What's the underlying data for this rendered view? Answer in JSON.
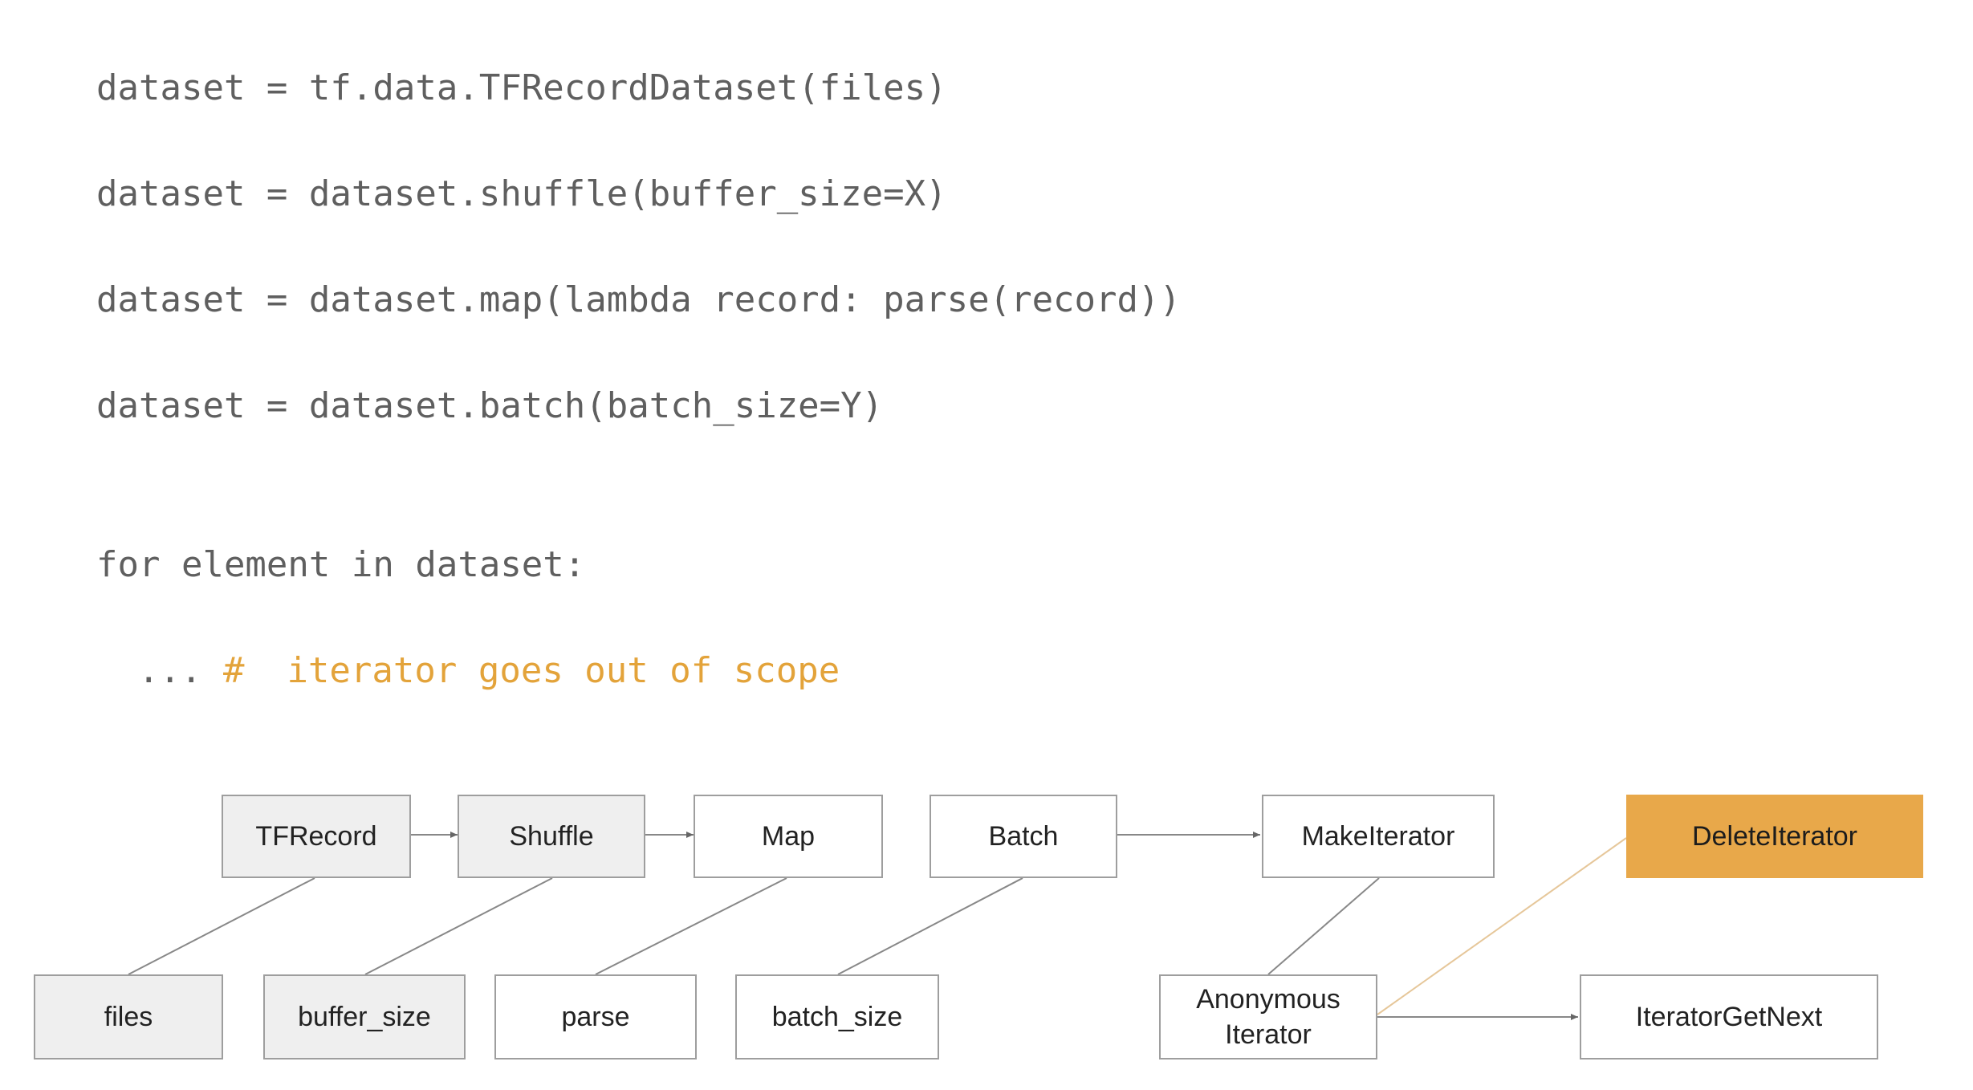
{
  "code": {
    "line1": "dataset = tf.data.TFRecordDataset(files)",
    "line2": "dataset = dataset.shuffle(buffer_size=X)",
    "line3": "dataset = dataset.map(lambda record: parse(record))",
    "line4": "dataset = dataset.batch(batch_size=Y)",
    "line5": "for element in dataset:",
    "line6_prefix": "... ",
    "line6_comment": "#  iterator goes out of scope"
  },
  "graph": {
    "tfrecord": "TFRecord",
    "shuffle": "Shuffle",
    "map": "Map",
    "batch": "Batch",
    "make_iterator": "MakeIterator",
    "delete_iterator": "DeleteIterator",
    "files": "files",
    "buffer_size": "buffer_size",
    "parse": "parse",
    "batch_size": "batch_size",
    "anonymous_iterator": "Anonymous\nIterator",
    "iterator_get_next": "IteratorGetNext"
  },
  "colors": {
    "code_text": "#5f5f5f",
    "comment": "#e3a33a",
    "highlight_node": "#e8a84a",
    "grey_node": "#efefef",
    "node_border": "#9e9e9e",
    "edge": "#888888",
    "highlight_edge": "#e6c79a"
  }
}
